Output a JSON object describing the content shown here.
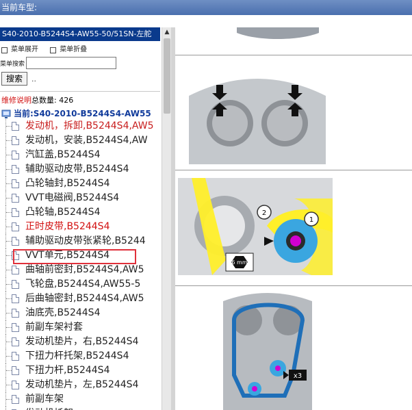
{
  "topbar": {
    "title": "当前车型:"
  },
  "left": {
    "header": "S40-2010-B5244S4-AW55-50/51SN-左舵",
    "menu_expand": "菜单展开",
    "menu_collapse": "菜单折叠",
    "search_label": "菜单搜索",
    "search_value": "",
    "search_button": "搜索",
    "search_dots": "..",
    "count_prefix": "维修说明",
    "count_label": "总数量:",
    "count_value": "426",
    "current_label": "当前:S40-2010-B5244S4-AW55",
    "items": [
      {
        "label": "发动机，拆卸,B5244S4,AW5",
        "style": "red"
      },
      {
        "label": "发动机，安装,B5244S4,AW",
        "style": "normal"
      },
      {
        "label": "汽缸盖,B5244S4",
        "style": "normal"
      },
      {
        "label": "辅助驱动皮带,B5244S4",
        "style": "normal"
      },
      {
        "label": "凸轮轴封,B5244S4",
        "style": "normal"
      },
      {
        "label": "VVT电磁阀,B5244S4",
        "style": "normal"
      },
      {
        "label": "凸轮轴,B5244S4",
        "style": "normal"
      },
      {
        "label": "正时皮带,B5244S4",
        "style": "highlight"
      },
      {
        "label": "辅助驱动皮带张紧轮,B5244",
        "style": "normal"
      },
      {
        "label": "VVT单元,B5244S4",
        "style": "normal"
      },
      {
        "label": "曲轴前密封,B5244S4,AW5",
        "style": "normal"
      },
      {
        "label": "飞轮盘,B5244S4,AW55-5",
        "style": "normal"
      },
      {
        "label": "后曲轴密封,B5244S4,AW5",
        "style": "normal"
      },
      {
        "label": "油底壳,B5244S4",
        "style": "normal"
      },
      {
        "label": "前副车架衬套",
        "style": "normal"
      },
      {
        "label": "发动机垫片，右,B5244S4",
        "style": "normal"
      },
      {
        "label": "下扭力杆托架,B5244S4",
        "style": "normal"
      },
      {
        "label": "下扭力杆,B5244S4",
        "style": "normal"
      },
      {
        "label": "发动机垫片，左,B5244S4",
        "style": "normal"
      },
      {
        "label": "前副车架",
        "style": "normal"
      },
      {
        "label": "发动机托架",
        "style": "normal"
      }
    ]
  },
  "right": {
    "callout_1": "1",
    "callout_2": "2",
    "tool_label": "6 mm",
    "qty_label": "x3"
  },
  "colors": {
    "header_bg": "#0a3a8c",
    "red_text": "#c81d1d",
    "highlight_box": "#e0303a",
    "belt": "#ffef2a",
    "pulley": "#3aa6e0"
  }
}
